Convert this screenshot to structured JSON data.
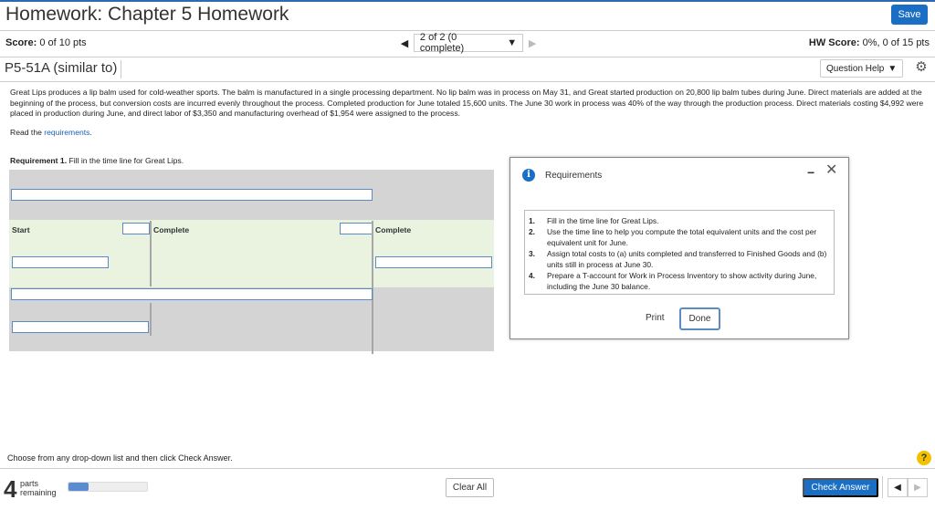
{
  "header": {
    "title": "Homework: Chapter 5 Homework",
    "save_label": "Save",
    "score_label": "Score:",
    "score_value": "0 of 10 pts",
    "pager_text": "2 of 2 (0 complete)",
    "prev_icon": "◀",
    "next_icon": "▶",
    "dropdown_icon": "▼",
    "hw_score_label": "HW Score:",
    "hw_score_value": "0%, 0 of 15 pts"
  },
  "question": {
    "id": "P5-51A (similar to)",
    "help_label": "Question Help",
    "help_icon": "▼",
    "gear_icon": "⚙"
  },
  "problem": {
    "text": "Great Lips produces a lip balm used for cold-weather sports. The balm is manufactured in a single processing department. No lip balm was in process on May 31, and Great started production on 20,800 lip balm tubes during June. Direct materials are added at the beginning of the process, but conversion costs are incurred evenly throughout the process. Completed production for June totaled 15,600 units. The June 30 work in process was 40% of the way through the production process. Direct materials costing $4,992 were placed in production during June, and direct labor of $3,350 and manufacturing overhead of $1,954 were assigned to the process.",
    "read_prefix": "Read the ",
    "read_link": "requirements",
    "read_suffix": "."
  },
  "requirement1": {
    "bold": "Requirement 1.",
    "text": " Fill in the time line for Great Lips."
  },
  "timeline": {
    "start_label": "Start",
    "complete_label_1": "Complete",
    "complete_label_2": "Complete",
    "inputs": {
      "top": "",
      "mid_complete": "",
      "right_complete": "",
      "row3_left": "",
      "row3_right": "",
      "row4_wide": "",
      "row5_left": ""
    }
  },
  "modal": {
    "info_icon": "i",
    "title": "Requirements",
    "minimize_icon": "−",
    "close_icon": "✕",
    "items": [
      {
        "num": "1.",
        "text": "Fill in the time line for Great Lips."
      },
      {
        "num": "2.",
        "text": "Use the time line to help you compute the total equivalent units and the cost per equivalent unit for June."
      },
      {
        "num": "3.",
        "text": "Assign total costs to (a) units completed and transferred to Finished Goods and (b) units still in process at June 30."
      },
      {
        "num": "4.",
        "text": "Prepare a T-account for Work in Process Inventory to show activity during June, including the June 30 balance."
      }
    ],
    "print_label": "Print",
    "done_label": "Done"
  },
  "footer": {
    "instructions": "Choose from any drop-down list and then click Check Answer.",
    "help_icon": "?",
    "parts_count": "4",
    "parts_label_1": "parts",
    "parts_label_2": "remaining",
    "progress_fraction": 0.25,
    "clear_all_label": "Clear All",
    "check_answer_label": "Check Answer",
    "prev_icon": "◀",
    "next_icon": "▶"
  }
}
